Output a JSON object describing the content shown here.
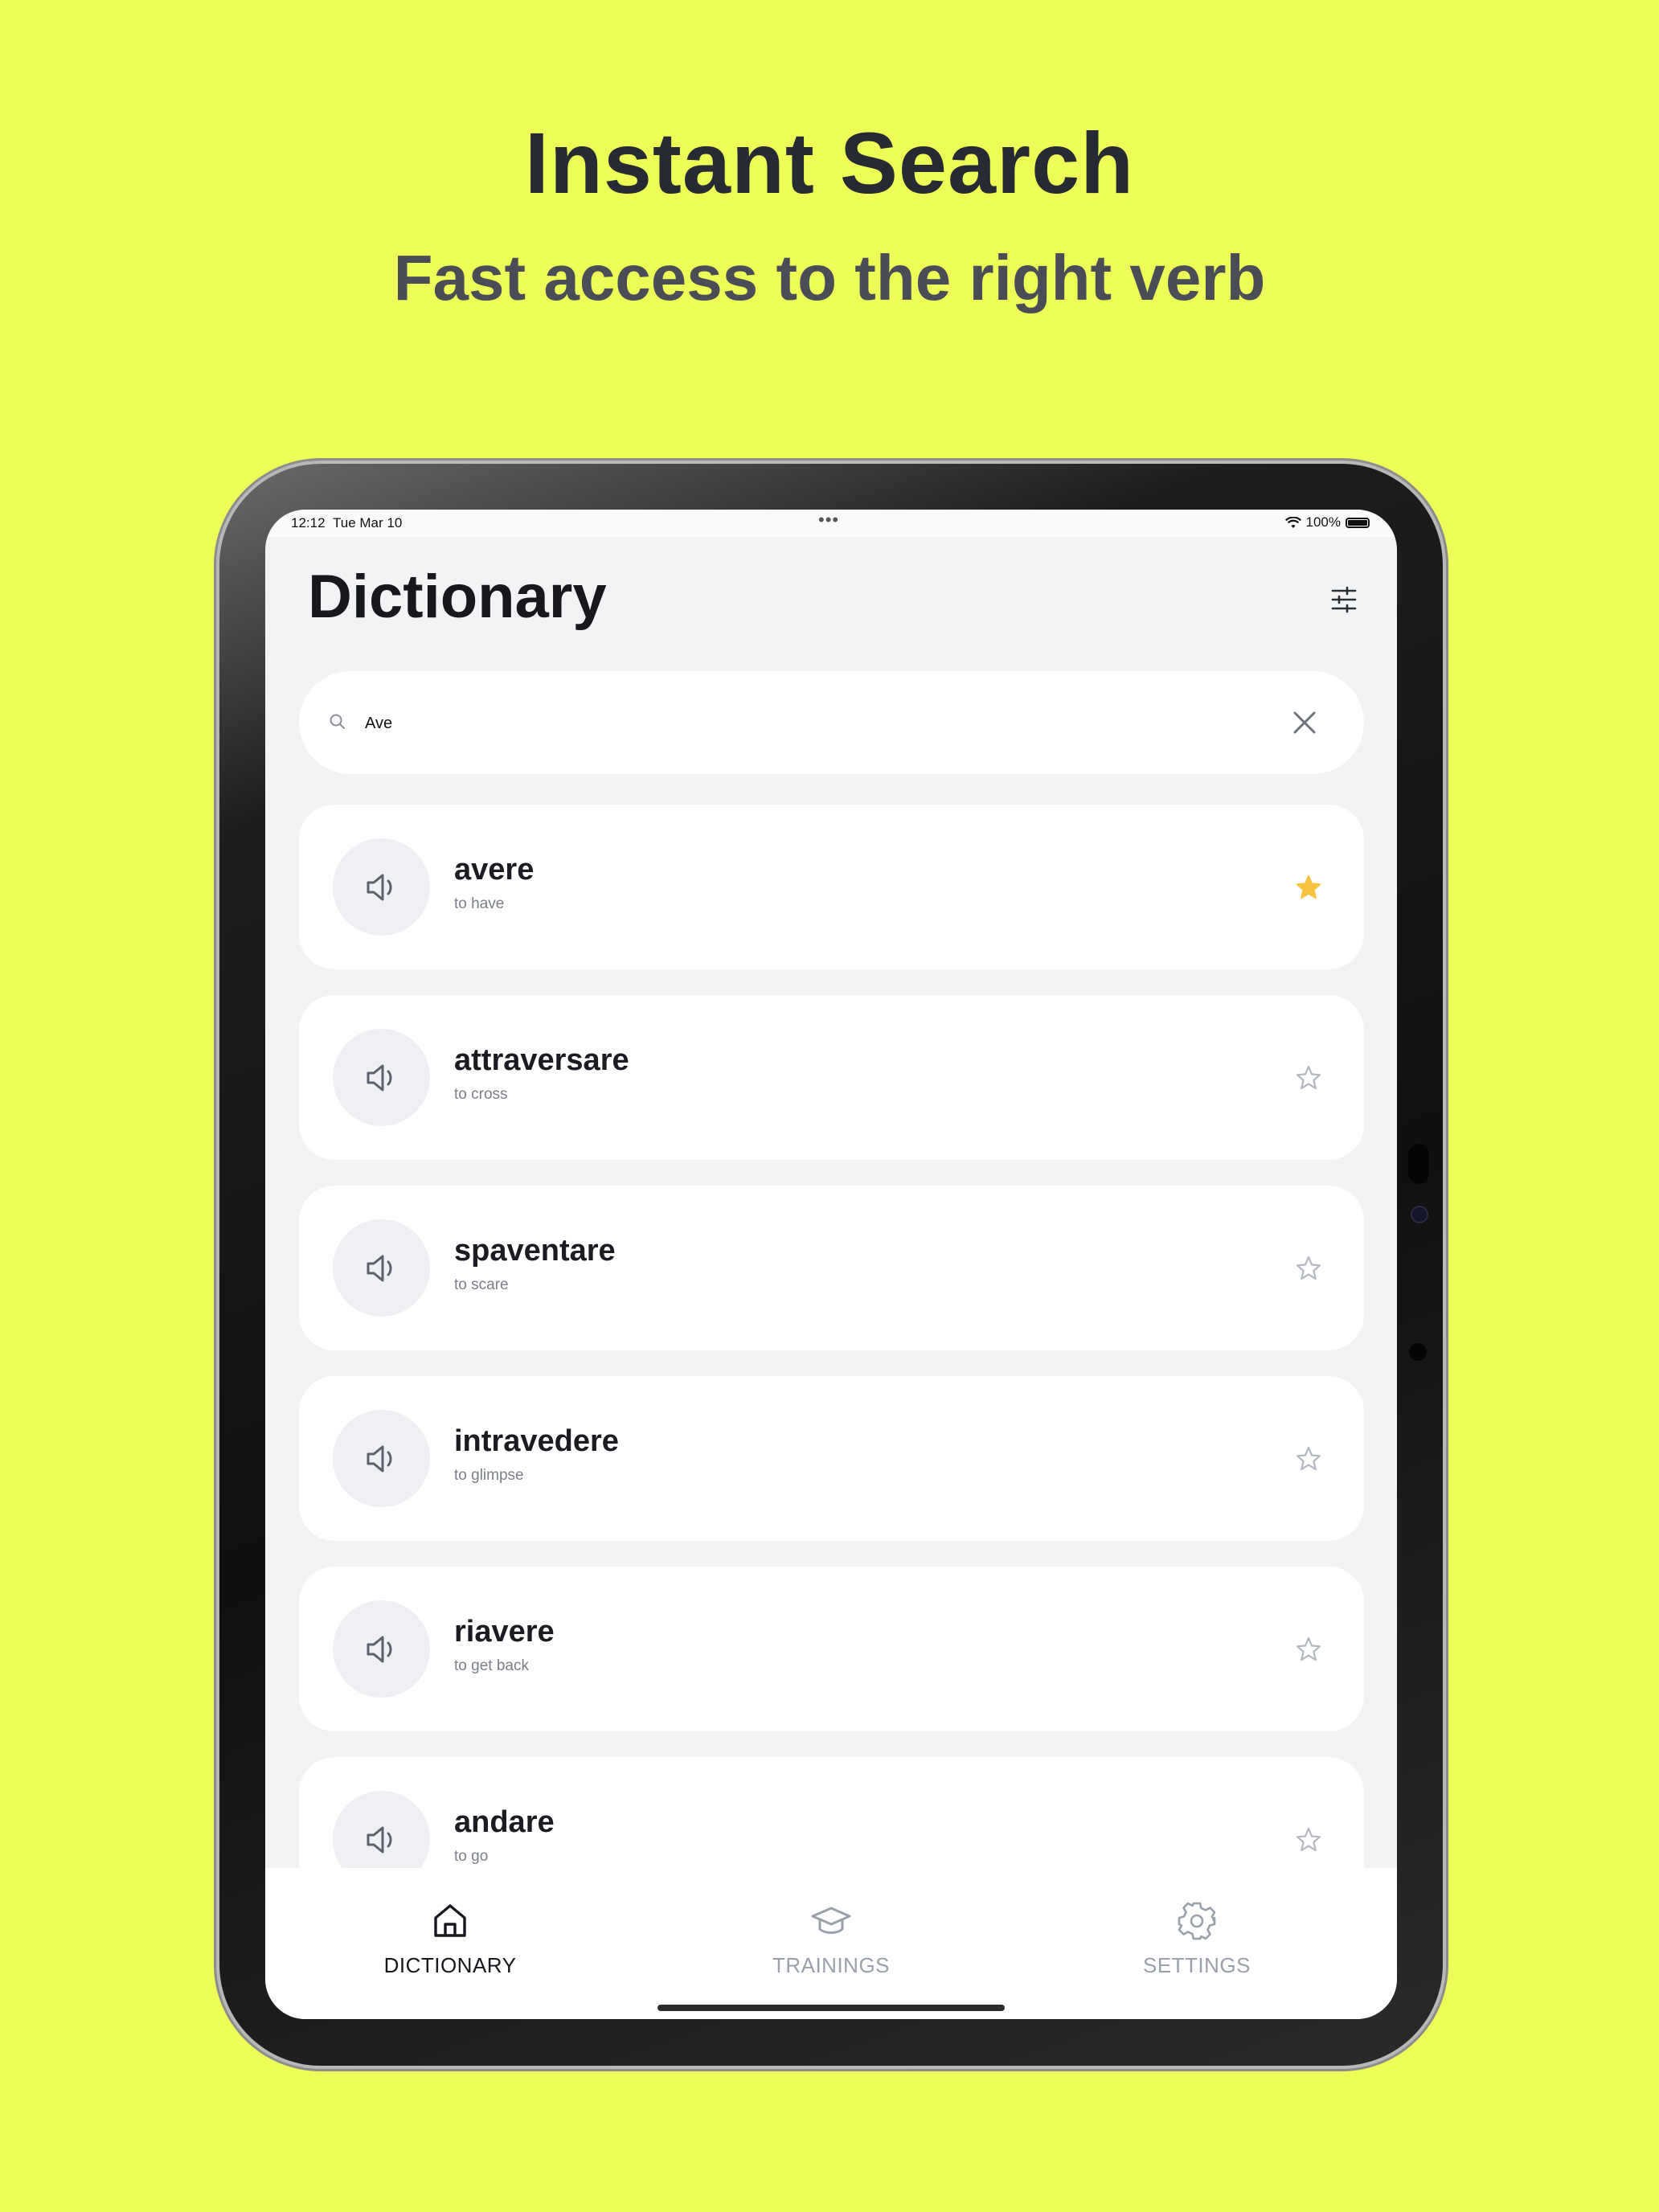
{
  "hero": {
    "title": "Instant Search",
    "subtitle": "Fast access to the right verb"
  },
  "status_bar": {
    "time": "12:12",
    "date": "Tue Mar 10",
    "multitask_dots": "•••",
    "battery": "100%"
  },
  "header": {
    "title": "Dictionary",
    "filter_icon": "sliders-icon"
  },
  "search": {
    "value": "Ave",
    "placeholder": "",
    "icon": "search-icon",
    "clear_icon": "close-icon"
  },
  "results": [
    {
      "verb": "avere",
      "translation": "to have",
      "favorite": true
    },
    {
      "verb": "attraversare",
      "translation": "to cross",
      "favorite": false
    },
    {
      "verb": "spaventare",
      "translation": "to scare",
      "favorite": false
    },
    {
      "verb": "intravedere",
      "translation": "to glimpse",
      "favorite": false
    },
    {
      "verb": "riavere",
      "translation": "to get back",
      "favorite": false
    },
    {
      "verb": "andare",
      "translation": "to go",
      "favorite": false
    }
  ],
  "tabs": [
    {
      "label": "DICTIONARY",
      "icon": "home-icon",
      "active": true
    },
    {
      "label": "TRAININGS",
      "icon": "graduation-cap-icon",
      "active": false
    },
    {
      "label": "SETTINGS",
      "icon": "gear-icon",
      "active": false
    }
  ],
  "colors": {
    "background": "#eefe58",
    "favorite_star": "#f7c23d",
    "inactive_star": "#b4b8c0",
    "active_tab": "#16181d",
    "inactive_tab": "#9aa0aa"
  }
}
